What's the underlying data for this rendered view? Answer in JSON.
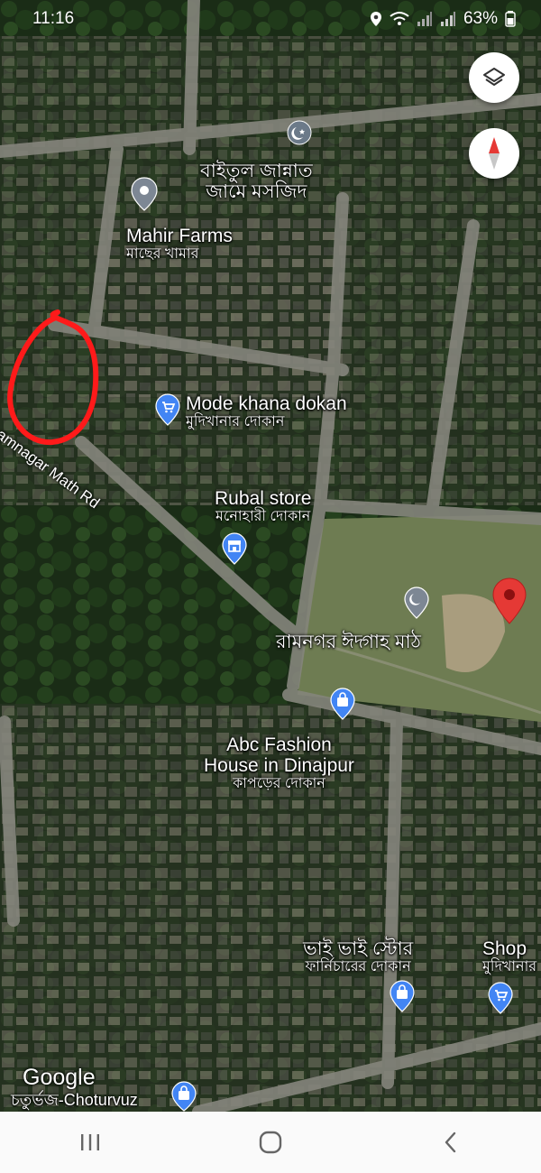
{
  "status_bar": {
    "time": "11:16",
    "battery": "63%",
    "icons": [
      "location-icon",
      "wifi-icon",
      "signal-icon",
      "signal-icon",
      "battery-icon"
    ]
  },
  "map_controls": {
    "layers_icon": "layers-icon",
    "compass_icon": "compass-icon"
  },
  "places": [
    {
      "id": "mosque-north",
      "lines": [
        "বাইতুল জান্নাত",
        "জামে মসজিদ"
      ],
      "icon": "mosque-icon"
    },
    {
      "id": "mahir-farms",
      "name": "Mahir Farms",
      "category": "মাছের খামার",
      "icon": "place-pin-icon"
    },
    {
      "id": "mode-khana",
      "name": "Mode khana dokan",
      "category": "মুদিখানার দোকান",
      "icon": "shopping-cart-icon"
    },
    {
      "id": "rubal-store",
      "name": "Rubal store",
      "category": "মনোহারী দোকান",
      "icon": "store-icon"
    },
    {
      "id": "eidgah",
      "name": "রামনগর ঈদ্গাহ মাঠ",
      "icon": "mosque-icon"
    },
    {
      "id": "abc-fashion",
      "name_lines": [
        "Abc Fashion",
        "House in Dinajpur"
      ],
      "category": "কাপড়ের দোকান",
      "icon": "shopping-bag-icon"
    },
    {
      "id": "bhai-bhai",
      "name": "ভাই ভাই স্টোর",
      "category": "ফার্নিচারের দোকান",
      "icon": "shopping-bag-icon"
    },
    {
      "id": "shop",
      "name": "Shop",
      "category": "মুদিখানার",
      "icon": "shopping-cart-icon"
    },
    {
      "id": "choturvuz",
      "name": "চতুর্ভজ-Choturvuz",
      "icon": "shopping-bag-icon"
    }
  ],
  "road": {
    "label": "amnagar Math Rd"
  },
  "dropped_pin": {
    "icon": "red-pin-icon",
    "color": "#e53935"
  },
  "annotation": {
    "shape": "hand-drawn-circle",
    "color": "#ff1a1a"
  },
  "branding": {
    "logo": "Google"
  },
  "nav_bar": {
    "buttons": [
      "recent-apps-icon",
      "home-icon",
      "back-icon"
    ]
  },
  "colors": {
    "vegetation": "#1d3319",
    "field": "#7a8a5c",
    "road": "#8a8a82",
    "pin_blue": "#4285f4",
    "pin_red": "#e53935"
  }
}
